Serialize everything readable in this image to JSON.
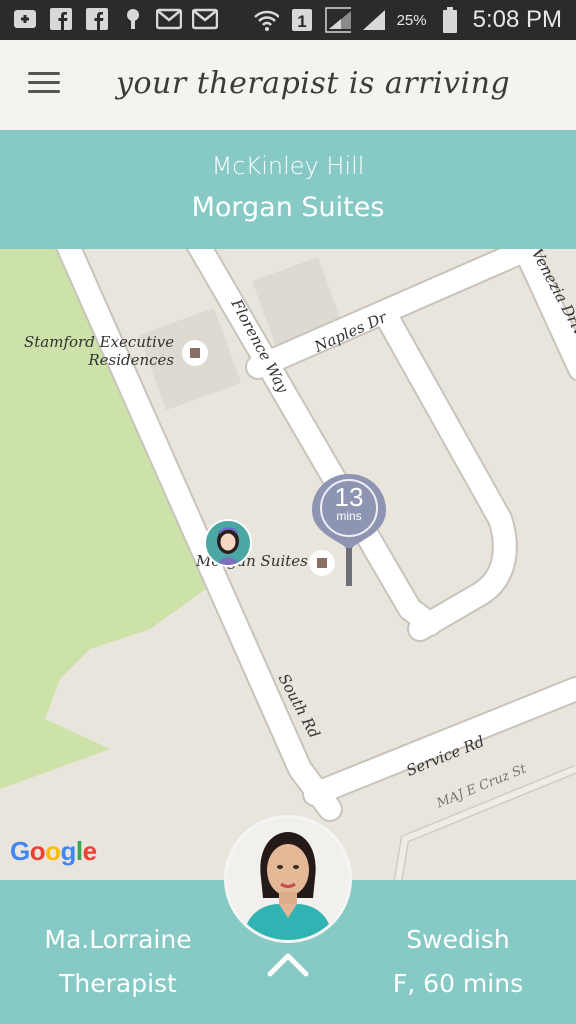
{
  "status_bar": {
    "icons": [
      "plus-box-icon",
      "facebook-icon",
      "facebook-icon",
      "app-icon",
      "gmail-icon",
      "gmail-icon",
      "wifi-icon",
      "sim-1-icon",
      "signal-icon",
      "signal-icon",
      "battery-icon"
    ],
    "battery": "25%",
    "time": "5:08 PM"
  },
  "app_bar": {
    "title": "your therapist is arriving",
    "menu_icon": "hamburger-menu-icon"
  },
  "location": {
    "area": "McKinley Hill",
    "place": "Morgan Suites"
  },
  "map": {
    "labels": {
      "stamford": "Stamford Executive\nResidences",
      "stamford_l1": "Stamford Executive",
      "stamford_l2": "Residences",
      "morgan": "Morgan Suites",
      "florence": "Florence Way",
      "naples": "Naples Dr",
      "venezia": "Venezia Drive",
      "south": "South Rd",
      "service": "Service Rd",
      "maj": "MAJ E Cruz St"
    },
    "eta": {
      "value": "13",
      "unit": "mins"
    },
    "logo": "Google",
    "colors": {
      "land": "#e9e5dc",
      "park": "#cce1a8",
      "road": "#ffffff",
      "eta_pin": "#8e95b3"
    }
  },
  "footer": {
    "therapist_name": "Ma.Lorraine",
    "therapist_role": "Therapist",
    "service": "Swedish",
    "session": "F, 60 mins",
    "accent": "#86c9c5"
  }
}
